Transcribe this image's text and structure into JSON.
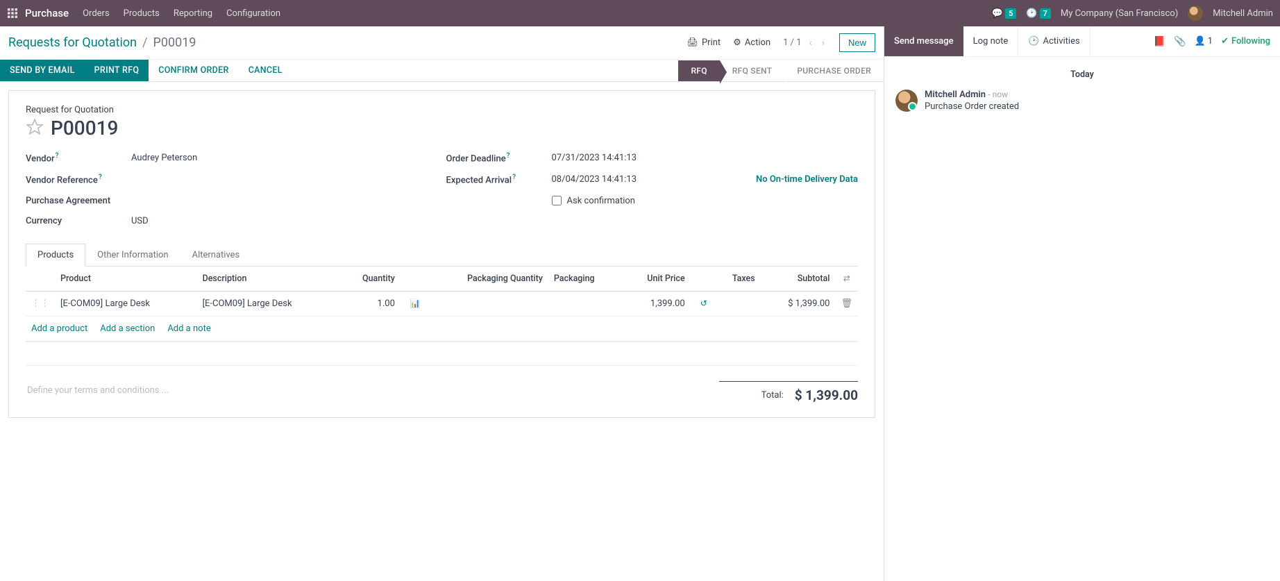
{
  "topbar": {
    "brand": "Purchase",
    "nav": [
      "Orders",
      "Products",
      "Reporting",
      "Configuration"
    ],
    "messages_badge": "5",
    "activities_badge": "7",
    "company": "My Company (San Francisco)",
    "user": "Mitchell Admin"
  },
  "breadcrumb": {
    "root": "Requests for Quotation",
    "current": "P00019",
    "print": "Print",
    "action": "Action",
    "pager": "1 / 1",
    "new": "New"
  },
  "action_bar": {
    "send_email": "SEND BY EMAIL",
    "print_rfq": "PRINT RFQ",
    "confirm": "CONFIRM ORDER",
    "cancel": "CANCEL",
    "status": [
      "RFQ",
      "RFQ SENT",
      "PURCHASE ORDER"
    ]
  },
  "form": {
    "subtitle": "Request for Quotation",
    "title": "P00019",
    "labels": {
      "vendor": "Vendor",
      "vendor_ref": "Vendor Reference",
      "purchase_agmt": "Purchase Agreement",
      "currency": "Currency",
      "deadline": "Order Deadline",
      "arrival": "Expected Arrival",
      "ask_conf": "Ask confirmation"
    },
    "values": {
      "vendor": "Audrey Peterson",
      "currency": "USD",
      "deadline": "07/31/2023 14:41:13",
      "arrival": "08/04/2023 14:41:13",
      "ontime": "No On-time Delivery Data"
    },
    "tabs": [
      "Products",
      "Other Information",
      "Alternatives"
    ],
    "columns": {
      "product": "Product",
      "description": "Description",
      "quantity": "Quantity",
      "pkg_qty": "Packaging Quantity",
      "packaging": "Packaging",
      "unit_price": "Unit Price",
      "taxes": "Taxes",
      "subtotal": "Subtotal"
    },
    "line": {
      "product": "[E-COM09] Large Desk",
      "description": "[E-COM09] Large Desk",
      "quantity": "1.00",
      "unit_price": "1,399.00",
      "subtotal": "$ 1,399.00"
    },
    "add_links": {
      "product": "Add a product",
      "section": "Add a section",
      "note": "Add a note"
    },
    "terms_placeholder": "Define your terms and conditions ...",
    "total_label": "Total:",
    "total_value": "$ 1,399.00"
  },
  "chatter": {
    "send": "Send message",
    "lognote": "Log note",
    "activities": "Activities",
    "follower_count": "1",
    "following": "Following",
    "date": "Today",
    "msg_author": "Mitchell Admin",
    "msg_time": "- now",
    "msg_text": "Purchase Order created"
  }
}
